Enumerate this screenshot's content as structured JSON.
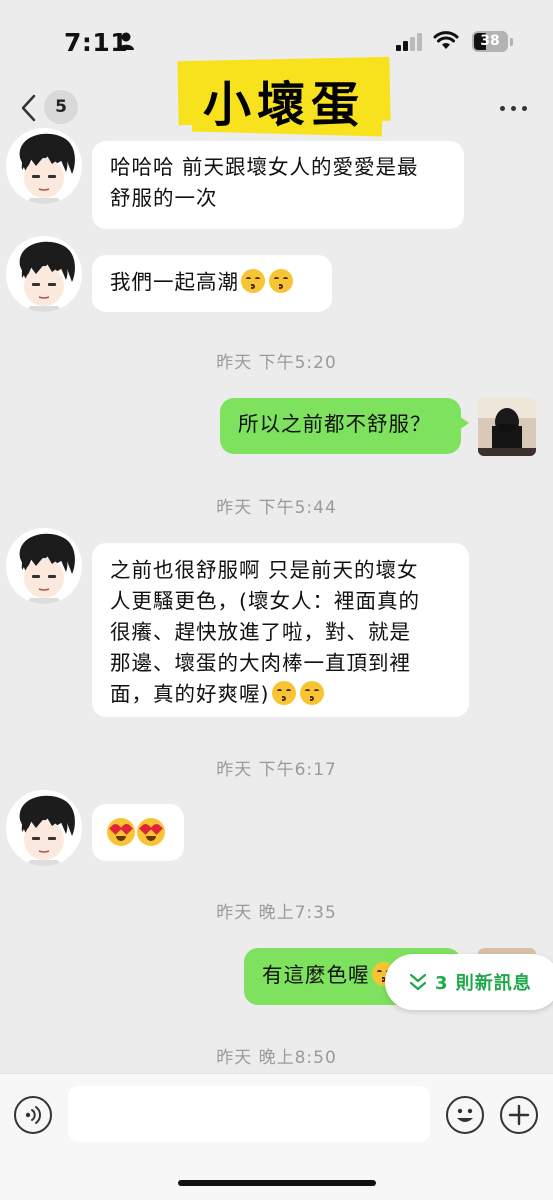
{
  "status_bar": {
    "time": "7:11",
    "battery": "38"
  },
  "header": {
    "unread_count": "5",
    "title": "小壞蛋"
  },
  "messages": [
    {
      "text_lines": [
        "哈哈哈 前天跟壞女人的愛愛是最",
        "舒服的一次"
      ]
    },
    {
      "text": "我們一起高潮"
    },
    {
      "time": "昨天 下午5:20"
    },
    {
      "text": "所以之前都不舒服？"
    },
    {
      "time": "昨天 下午5:44"
    },
    {
      "text_lines": [
        "之前也很舒服啊 只是前天的壞女",
        "人更騷更色，(壞女人：裡面真的",
        "很癢、趕快放進了啦，對、就是",
        "那邊、壞蛋的大肉棒一直頂到裡",
        "面，真的好爽喔)"
      ]
    },
    {
      "time": "昨天 下午6:17"
    },
    {
      "time": "昨天 晚上7:35"
    },
    {
      "text": "有這麼色喔"
    },
    {
      "time": "昨天 晚上8:50"
    }
  ],
  "new_messages_label": "3 則新訊息",
  "input": {
    "placeholder": ""
  },
  "icons": {
    "person": "person-icon",
    "signal": "signal-icon",
    "wifi": "wifi-icon",
    "back": "chevron-left-icon",
    "more": "more-dots-icon",
    "voice": "voice-icon",
    "emoji": "emoji-icon",
    "plus": "plus-icon",
    "double_chevron": "double-chevron-down-icon"
  },
  "colors": {
    "outgoing_bubble": "#7ee25f",
    "incoming_bubble": "#ffffff",
    "accent": "#1fa84a",
    "title_highlight": "#f8e21e",
    "background": "#ececec"
  }
}
